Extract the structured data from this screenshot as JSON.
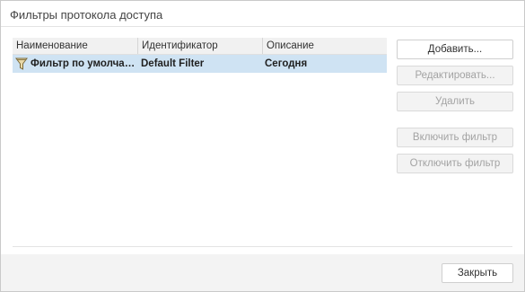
{
  "dialog": {
    "title": "Фильтры протокола доступа"
  },
  "list": {
    "columns": [
      "Наименование",
      "Идентификатор",
      "Описание"
    ],
    "rows": [
      {
        "icon": "filter-icon",
        "name": "Фильтр по умолча…",
        "identifier": "Default Filter",
        "description": "Сегодня",
        "selected": true
      }
    ]
  },
  "buttons": {
    "add": "Добавить...",
    "edit": "Редактировать...",
    "delete": "Удалить",
    "enable": "Включить фильтр",
    "disable": "Отключить фильтр",
    "close": "Закрыть"
  },
  "colors": {
    "selection": "#cfe3f3",
    "footer": "#f3f3f3",
    "disabled_text": "#a3a3a3"
  }
}
